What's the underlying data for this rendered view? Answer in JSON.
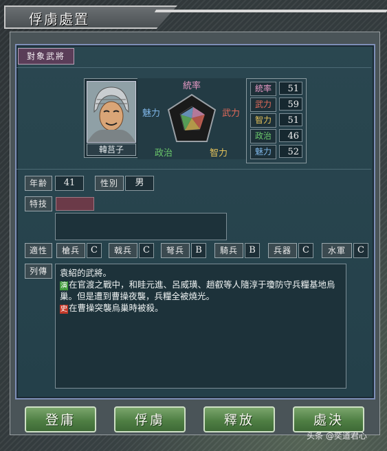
{
  "title": "俘虜處置",
  "target_tag": "對象武將",
  "officer": {
    "name": "韓莒子",
    "pentagon_labels": {
      "lead": "統率",
      "war": "武力",
      "int": "智力",
      "pol": "政治",
      "chr": "魅力"
    },
    "stats": [
      {
        "label": "統率",
        "value": "51",
        "color": "#e79ac6"
      },
      {
        "label": "武力",
        "value": "59",
        "color": "#e36a5a"
      },
      {
        "label": "智力",
        "value": "51",
        "color": "#e6c35a"
      },
      {
        "label": "政治",
        "value": "46",
        "color": "#6bc86b"
      },
      {
        "label": "魅力",
        "value": "52",
        "color": "#7fb6e8"
      }
    ]
  },
  "profile": {
    "age_label": "年齢",
    "age": "41",
    "gender_label": "性別",
    "gender": "男",
    "skill_label": "特技"
  },
  "aptitude": {
    "label": "適性",
    "items": [
      {
        "label": "槍兵",
        "grade": "C"
      },
      {
        "label": "戟兵",
        "grade": "C"
      },
      {
        "label": "弩兵",
        "grade": "B"
      },
      {
        "label": "騎兵",
        "grade": "B"
      },
      {
        "label": "兵器",
        "grade": "C"
      },
      {
        "label": "水軍",
        "grade": "C"
      }
    ]
  },
  "bio": {
    "label": "列傳",
    "line1": "袁紹的武將。",
    "mark1": "演",
    "mark1_color": "#3f9a3a",
    "line2": "在官渡之戰中，和眭元進、呂威璜、趙叡等人隨淳于瓊防守兵糧基地烏巢。但是遭到曹操夜襲，兵糧全被燒光。",
    "mark2": "史",
    "mark2_color": "#c23a2a",
    "line3": "在曹操突襲烏巢時被殺。"
  },
  "buttons": [
    {
      "label": "登庸"
    },
    {
      "label": "俘虜"
    },
    {
      "label": "釋放"
    },
    {
      "label": "處決"
    }
  ],
  "watermark": "头条 @奕道君心"
}
